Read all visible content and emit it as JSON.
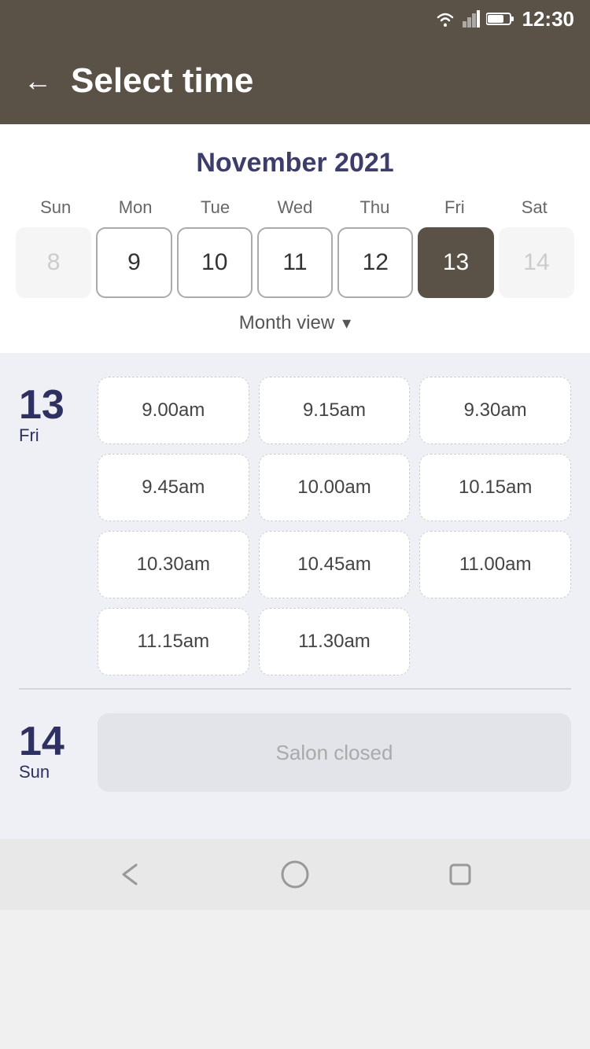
{
  "statusBar": {
    "time": "12:30"
  },
  "header": {
    "back_label": "←",
    "title": "Select time"
  },
  "calendar": {
    "monthYear": "November 2021",
    "weekdays": [
      "Sun",
      "Mon",
      "Tue",
      "Wed",
      "Thu",
      "Fri",
      "Sat"
    ],
    "days": [
      {
        "num": "8",
        "state": "dimmed"
      },
      {
        "num": "9",
        "state": "outlined"
      },
      {
        "num": "10",
        "state": "outlined"
      },
      {
        "num": "11",
        "state": "outlined"
      },
      {
        "num": "12",
        "state": "outlined"
      },
      {
        "num": "13",
        "state": "selected"
      },
      {
        "num": "14",
        "state": "dimmed"
      }
    ],
    "monthViewLabel": "Month view"
  },
  "timeSlots": {
    "day13": {
      "dayNum": "13",
      "dayName": "Fri",
      "slots": [
        "9.00am",
        "9.15am",
        "9.30am",
        "9.45am",
        "10.00am",
        "10.15am",
        "10.30am",
        "10.45am",
        "11.00am",
        "11.15am",
        "11.30am"
      ]
    },
    "day14": {
      "dayNum": "14",
      "dayName": "Sun",
      "closedLabel": "Salon closed"
    }
  },
  "navBar": {
    "back": "back-icon",
    "home": "home-icon",
    "recent": "recent-icon"
  }
}
